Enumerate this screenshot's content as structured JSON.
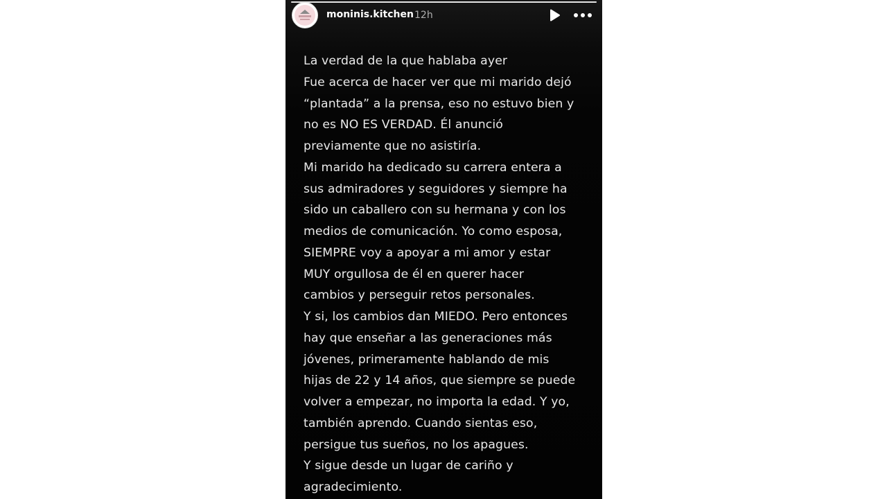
{
  "story": {
    "username": "moninis.kitchen",
    "timestamp": "12h",
    "progress": 1.0,
    "controls": {
      "play_icon": "play-icon",
      "more_icon": "more-options-icon"
    },
    "lines": [
      "La verdad de la que hablaba ayer",
      "Fue acerca de hacer ver que mi marido dejó",
      "“plantada” a la prensa, eso no estuvo bien y",
      "no es NO ES VERDAD. Él anunció",
      "previamente que no asistiría.",
      "Mi marido ha dedicado su carrera entera a",
      "sus admiradores y seguidores y siempre ha",
      "sido un caballero con su hermana y con los",
      "medios de comunicación. Yo como esposa,",
      "SIEMPRE voy a apoyar a mi amor y estar",
      "MUY orgullosa de él en querer hacer",
      "cambios y perseguir retos personales.",
      "Y si, los cambios dan MIEDO. Pero entonces",
      "hay que enseñar a las generaciones más",
      "jóvenes, primeramente hablando de mis",
      "hijas de 22 y 14 años, que siempre se puede",
      "volver a empezar, no importa la edad. Y yo,",
      "también aprendo. Cuando sientas eso,",
      "persigue tus sueños, no los apagues.",
      "Y sigue desde un lugar de cariño y",
      "agradecimiento."
    ]
  }
}
